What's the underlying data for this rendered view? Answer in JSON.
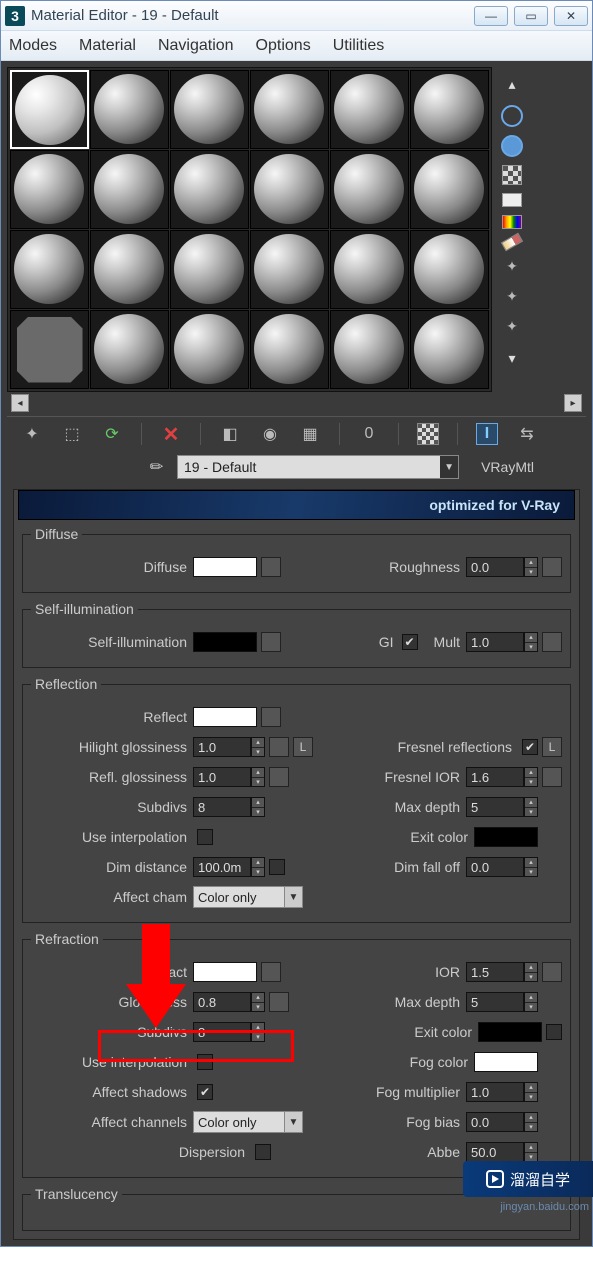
{
  "window": {
    "title": "Material Editor - 19 - Default"
  },
  "menu": {
    "modes": "Modes",
    "material": "Material",
    "navigation": "Navigation",
    "options": "Options",
    "utilities": "Utilities"
  },
  "toolbar_icons": {
    "wand": "✦",
    "pick": "⬚",
    "assign": "⟳",
    "delete": "✕",
    "put": "◧",
    "show": "◉",
    "bg": "▦",
    "opts": "◫",
    "checker": "▩",
    "ilabel": "I",
    "arrows": "⇆"
  },
  "matname": {
    "value": "19 - Default",
    "type": "VRayMtl"
  },
  "banner": {
    "text": "optimized for V-Ray"
  },
  "diffuse": {
    "legend": "Diffuse",
    "diffuse_lbl": "Diffuse",
    "roughness_lbl": "Roughness",
    "roughness_val": "0.0"
  },
  "selfillum": {
    "legend": "Self-illumination",
    "lbl": "Self-illumination",
    "gi_lbl": "GI",
    "mult_lbl": "Mult",
    "mult_val": "1.0"
  },
  "reflection": {
    "legend": "Reflection",
    "reflect_lbl": "Reflect",
    "hilight_lbl": "Hilight glossiness",
    "hilight_val": "1.0",
    "reflgloss_lbl": "Refl. glossiness",
    "reflgloss_val": "1.0",
    "subdivs_lbl": "Subdivs",
    "subdivs_val": "8",
    "useinterp_lbl": "Use interpolation",
    "dimdist_lbl": "Dim distance",
    "dimdist_val": "100.0m",
    "affectch_lbl": "Affect cham",
    "affectch_val": "Color only",
    "L": "L",
    "fresnel_lbl": "Fresnel reflections",
    "fresnelior_lbl": "Fresnel IOR",
    "fresnelior_val": "1.6",
    "maxdepth_lbl": "Max depth",
    "maxdepth_val": "5",
    "exitcolor_lbl": "Exit color",
    "dimfall_lbl": "Dim fall off",
    "dimfall_val": "0.0"
  },
  "refraction": {
    "legend": "Refraction",
    "refract_lbl": "Refract",
    "gloss_lbl": "Glossiness",
    "gloss_val": "0.8",
    "subdivs_lbl": "Subdivs",
    "subdivs_val": "8",
    "useinterp_lbl": "Use interpolation",
    "affectsh_lbl": "Affect shadows",
    "affectch_lbl": "Affect channels",
    "affectch_val": "Color only",
    "dispersion_lbl": "Dispersion",
    "ior_lbl": "IOR",
    "ior_val": "1.5",
    "maxdepth_lbl": "Max depth",
    "maxdepth_val": "5",
    "exitcolor_lbl": "Exit color",
    "fogcolor_lbl": "Fog color",
    "fogmult_lbl": "Fog multiplier",
    "fogmult_val": "1.0",
    "fogbias_lbl": "Fog bias",
    "fogbias_val": "0.0",
    "abbe_lbl": "Abbe",
    "abbe_val": "50.0"
  },
  "translucency": {
    "legend": "Translucency"
  },
  "watermark": {
    "text": "溜溜自学",
    "url": "jingyan.baidu.com"
  }
}
